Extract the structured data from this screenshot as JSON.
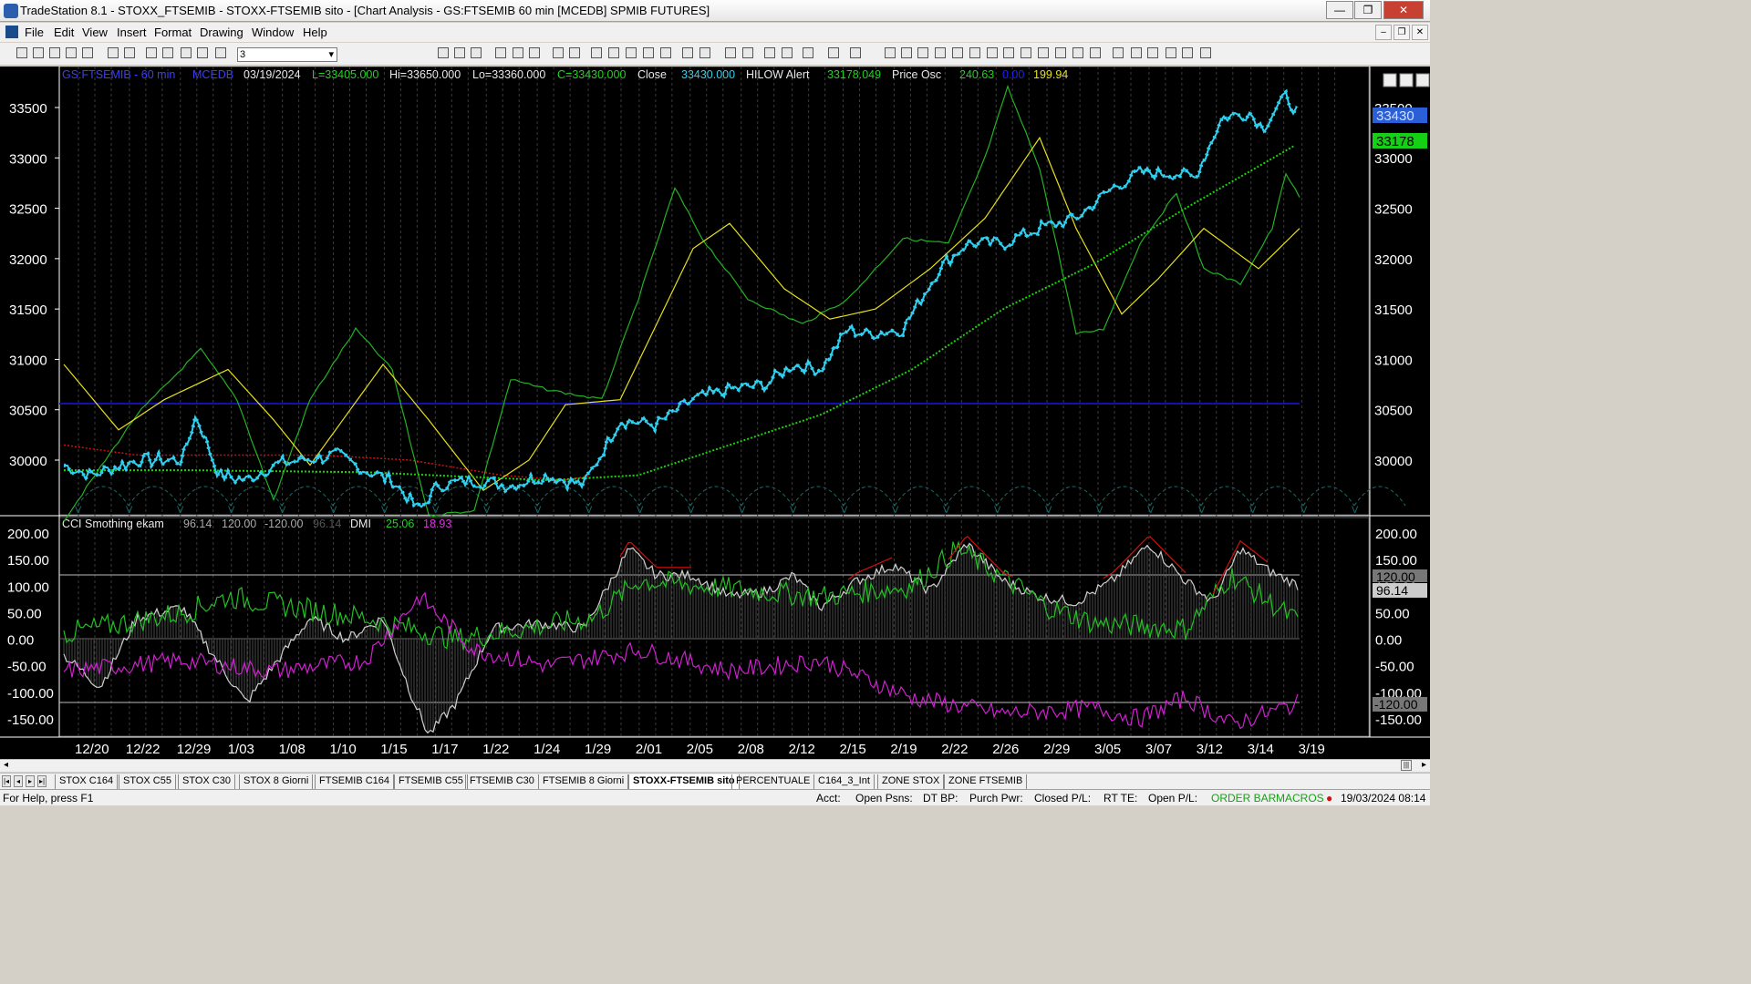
{
  "window": {
    "title": "TradeStation 8.1 - STOXX_FTSEMIB - STOXX-FTSEMIB sito - [Chart Analysis - GS:FTSEMIB  60 min  [MCEDB] SPMIB FUTURES]",
    "min_label": "—",
    "restore_label": "❐",
    "close_label": "✕"
  },
  "menu": [
    "File",
    "Edit",
    "View",
    "Insert",
    "Format",
    "Drawing",
    "Window",
    "Help"
  ],
  "mdi_buttons": [
    "–",
    "❐",
    "✕"
  ],
  "toolbar": {
    "interval_value": "3",
    "icon_names": [
      "new",
      "open",
      "new-window",
      "new-workspace",
      "open-workspace",
      "print",
      "print-preview",
      "screen",
      "lock",
      "draw",
      "macro",
      "zoom-in",
      "zoom-out",
      "select",
      "cursor",
      "hand",
      "line",
      "text"
    ]
  },
  "chart": {
    "symbol_label": "GS:FTSEMIB - 60 min",
    "data_source": "MCEDB",
    "date": "03/19/2024",
    "low": "L=33405.000",
    "high": "Hi=33650.000",
    "lo": "Lo=33360.000",
    "close": "C=33430.000",
    "close_label": "Close",
    "close_value": "33430.000",
    "hilow_label": "HILOW Alert",
    "hilow_value": "33178.049",
    "osc_label": "Price Osc",
    "osc_v1": "240.63",
    "osc_v2": "0.00",
    "osc_v3": "199.94",
    "last_price_tag": "33430",
    "hilow_tag": "33178",
    "price_axis": [
      "33500",
      "33000",
      "32500",
      "32000",
      "31500",
      "31000",
      "30500",
      "30000"
    ],
    "price_axis_right": [
      "33500",
      "33000",
      "32500",
      "32000",
      "31500",
      "31000",
      "30500",
      "30000"
    ],
    "lower_label": "CCI Smothing ekam",
    "lower_v1": "96.14",
    "lower_v2": "120.00",
    "lower_v3": "-120.00",
    "lower_v4": "96.14",
    "dmi_label": "DMI",
    "dmi_plus": "25.06",
    "dmi_minus": "18.93",
    "lower_axis": [
      "200.00",
      "150.00",
      "100.00",
      "50.00",
      "0.00",
      "-50.00",
      "-100.00",
      "-150.00"
    ],
    "lower_axis_right": [
      "200.00",
      "150.00",
      "100.00",
      "50.00",
      "0.00",
      "-50.00",
      "-100.00",
      "-150.00"
    ],
    "lower_tag_120": "120.00",
    "lower_tag_96": "96.14",
    "lower_tag_m120": "-120.00",
    "dates": [
      "12/20",
      "12/22",
      "12/29",
      "1/03",
      "1/08",
      "1/10",
      "1/15",
      "1/17",
      "1/22",
      "1/24",
      "1/29",
      "2/01",
      "2/05",
      "2/08",
      "2/12",
      "2/15",
      "2/19",
      "2/22",
      "2/26",
      "2/29",
      "3/05",
      "3/07",
      "3/12",
      "3/14",
      "3/19"
    ],
    "colors": {
      "price": "#2fd0f0",
      "avg": "#1fd00f",
      "yellow": "#e8e01a",
      "green": "#23b223",
      "red": "#d01010",
      "hline": "#1212a8",
      "magenta": "#e030e0",
      "white": "#d8d8d8"
    }
  },
  "tabs": [
    "STOX C164",
    "STOX C55",
    "STOX C30",
    "STOX 8 Giorni",
    "FTSEMIB C164",
    "FTSEMIB C55",
    "FTSEMIB C30",
    "FTSEMIB 8 Giorni",
    "STOXX-FTSEMIB sito",
    "PERCENTUALE",
    "C164_3_Int",
    "ZONE STOX",
    "ZONE FTSEMIB"
  ],
  "active_tab": "STOXX-FTSEMIB sito",
  "status": {
    "help": "For Help, press F1",
    "acct": "Acct:",
    "open_psns": "Open Psns:",
    "dt_bp": "DT BP:",
    "purch_pwr": "Purch Pwr:",
    "closed_pl": "Closed P/L:",
    "rt_te": "RT TE:",
    "open_pl": "Open P/L:",
    "order_bar": "ORDER BAR",
    "macros": "MACROS",
    "datetime": "19/03/2024 08:14"
  }
}
